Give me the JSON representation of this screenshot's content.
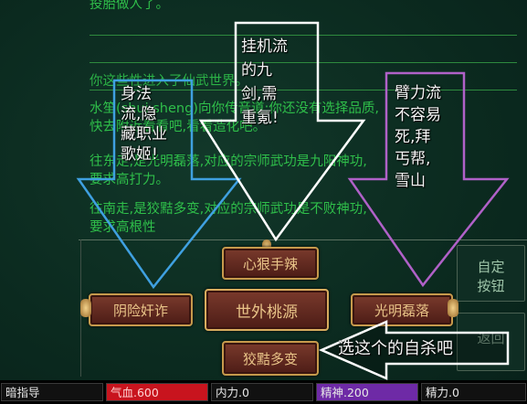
{
  "log": {
    "lines": [
      "投胎做人了。",
      "你这些性进入了仙武世界。",
      "水笙(shui sheng)向你传音道:你还没有选择品质,",
      "快去附近看看吧,看看造化吧。",
      "往东走,是光明磊落,对应的宗师武功是九阳神功,",
      "要求高打力。",
      "往南走,是狡黠多变,对应的宗师武功是不败神功,",
      "要求高根性"
    ]
  },
  "buttons": {
    "north": "心狠手辣",
    "west": "阴险奸诈",
    "center": "世外桃源",
    "east": "光明磊落",
    "south": "狡黠多变"
  },
  "side": {
    "custom_button": "自定\n按钮",
    "partial": "返回"
  },
  "status": {
    "hint": "暗指导",
    "hp": "气血.600",
    "neili": "内力.0",
    "jingshen": "精神.200",
    "jingli": "精力.0"
  },
  "annotations": {
    "blue": [
      "身法",
      "流,隐",
      "藏职业",
      "歌姬!"
    ],
    "white": [
      "挂机流",
      "的九",
      "剑,需",
      "重氪!"
    ],
    "purple": [
      "臂力流",
      "不容易",
      "死,拜",
      "丐帮,",
      "雪山"
    ],
    "bottom": "选这个的自杀吧"
  },
  "colors": {
    "log_text": "#2fbf4a",
    "hp_bar": "#c8141e",
    "jingshen_bar": "#6e2aa6",
    "blue_arrow": "#3fa0e0",
    "purple_arrow": "#b061c8",
    "white_arrow": "#ffffff",
    "button_gold": "#c69a4c"
  }
}
